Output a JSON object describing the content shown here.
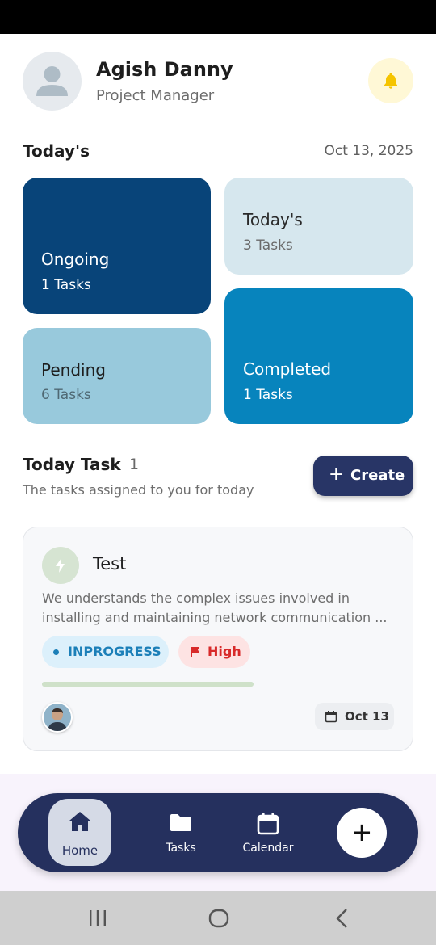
{
  "profile": {
    "name": "Agish Danny",
    "role": "Project Manager"
  },
  "icons": {
    "avatar": "user-placeholder-icon",
    "bell": "bell-icon",
    "task": "bolt-icon",
    "priority": "flag-icon",
    "date": "calendar-icon",
    "home": "home-icon",
    "tasks": "folder-icon",
    "calendar": "calendar-icon",
    "add": "plus-icon"
  },
  "summary": {
    "title": "Today's",
    "date": "Oct 13, 2025",
    "cards": {
      "ongoing": {
        "label": "Ongoing",
        "count": "1 Tasks",
        "color": "#084479"
      },
      "today": {
        "label": "Today's",
        "count": "3 Tasks",
        "color": "#d6e7ee"
      },
      "pending": {
        "label": "Pending",
        "count": "6 Tasks",
        "color": "#98c9dc"
      },
      "completed": {
        "label": "Completed",
        "count": "1 Tasks",
        "color": "#0784bd"
      }
    }
  },
  "today_task": {
    "heading": "Today Task",
    "count": "1",
    "subtitle": "The tasks assigned to you for today",
    "create_label": "Create",
    "create_symbol": "+"
  },
  "tasks": [
    {
      "title": "Test",
      "description": "We understands the complex issues involved in installing and maintaining network communication ...",
      "status": "INPROGRESS",
      "status_color": "#1b7fb8",
      "priority": "High",
      "priority_color": "#d82a2a",
      "progress": 1.0,
      "date": "Oct 13"
    }
  ],
  "nav": {
    "home": "Home",
    "tasks": "Tasks",
    "calendar": "Calendar",
    "add_symbol": "+"
  },
  "colors": {
    "accent": "#25305e",
    "bell_bg": "#fff8d6",
    "bell": "#f5c400"
  }
}
